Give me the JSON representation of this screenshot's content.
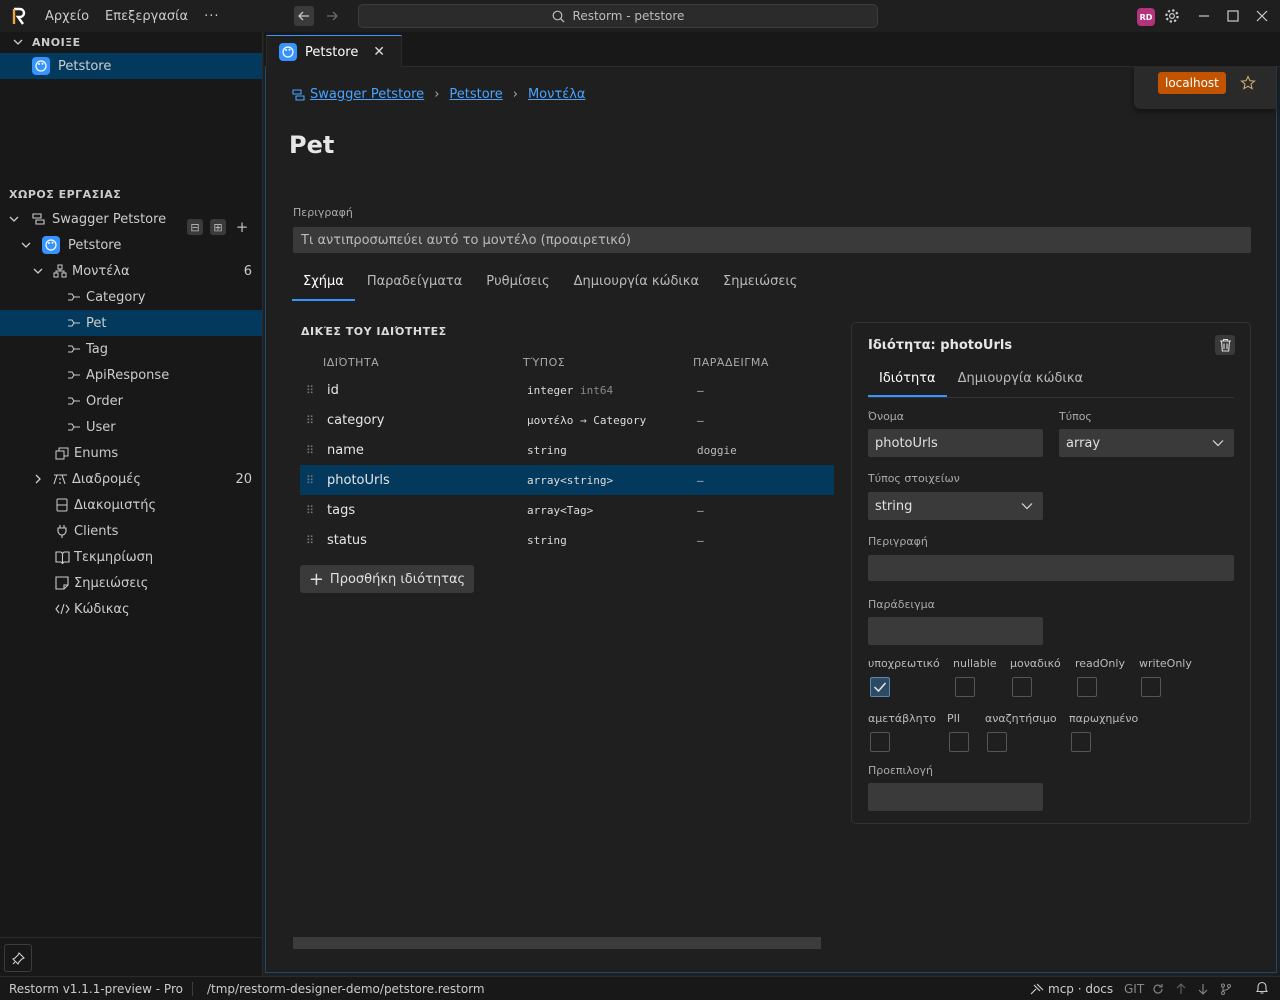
{
  "titlebar": {
    "menus": [
      "Αρχείο",
      "Επεξεργασία"
    ],
    "more": "···",
    "search_text": "Restorm - petstore",
    "avatar_initials": "RD"
  },
  "sidebar": {
    "open_header": "ΑΝΟΙΞΕ",
    "open_item": "Petstore",
    "workspace_header": "ΧΩΡΟΣ ΕΡΓΑΣΙΑΣ",
    "tree": {
      "root": "Swagger Petstore",
      "api": "Petstore",
      "models": {
        "label": "Μοντέλα",
        "count": "6"
      },
      "model_items": [
        "Category",
        "Pet",
        "Tag",
        "ApiResponse",
        "Order",
        "User"
      ],
      "enums": "Enums",
      "routes": {
        "label": "Διαδρομές",
        "count": "20"
      },
      "servers": "Διακομιστής",
      "clients": "Clients",
      "docs": "Τεκμηρίωση",
      "notes": "Σημειώσεις",
      "code": "Κώδικας"
    }
  },
  "editor_tab": {
    "label": "Petstore",
    "close": "✕"
  },
  "env": {
    "badge": "localhost"
  },
  "breadcrumb": [
    "Swagger Petstore",
    "Petstore",
    "Μοντέλα"
  ],
  "model": {
    "title": "Pet",
    "description_label": "Περιγραφή",
    "description_placeholder": "Τι αντιπροσωπεύει αυτό το μοντέλο (προαιρετικό)"
  },
  "tabs": [
    "Σχήμα",
    "Παραδείγματα",
    "Ρυθμίσεις",
    "Δημιουργία κώδικα",
    "Σημειώσεις"
  ],
  "properties": {
    "header": "ΔΙΚΈΣ ΤΟΥ ΙΔΙΌΤΗΤΕΣ",
    "columns": [
      "ΙΔΙΌΤΗΤΑ",
      "ΤΎΠΟΣ",
      "ΠΑΡΆΔΕΙΓΜΑ"
    ],
    "rows": [
      {
        "name": "id",
        "type": "integer",
        "format": "int64",
        "example": "–"
      },
      {
        "name": "category",
        "type": "μοντέλο → Category",
        "format": "",
        "example": "–"
      },
      {
        "name": "name",
        "type": "string",
        "format": "",
        "example": "doggie"
      },
      {
        "name": "photoUrls",
        "type": "array<string>",
        "format": "",
        "example": "–"
      },
      {
        "name": "tags",
        "type": "array<Tag>",
        "format": "",
        "example": "–"
      },
      {
        "name": "status",
        "type": "string",
        "format": "",
        "example": "–"
      }
    ],
    "add_label": "Προσθήκη ιδιότητας"
  },
  "detail": {
    "title": "Ιδιότητα: photoUrls",
    "tabs": [
      "Ιδιότητα",
      "Δημιουργία κώδικα"
    ],
    "name_label": "Όνομα",
    "name_value": "photoUrls",
    "type_label": "Τύπος",
    "type_value": "array",
    "item_type_label": "Τύπος στοιχείων",
    "item_type_value": "string",
    "description_label": "Περιγραφή",
    "example_label": "Παράδειγμα",
    "flags": [
      {
        "label": "υποχρεωτικό",
        "checked": true
      },
      {
        "label": "nullable",
        "checked": false
      },
      {
        "label": "μοναδικό",
        "checked": false
      },
      {
        "label": "readOnly",
        "checked": false
      },
      {
        "label": "writeOnly",
        "checked": false
      },
      {
        "label": "αμετάβλητο",
        "checked": false
      },
      {
        "label": "PII",
        "checked": false
      },
      {
        "label": "αναζητήσιμο",
        "checked": false
      },
      {
        "label": "παρωχημένο",
        "checked": false
      }
    ],
    "default_label": "Προεπιλογή"
  },
  "statusbar": {
    "version": "Restorm v1.1.1-preview - Pro",
    "path": "/tmp/restorm-designer-demo/petstore.restorm",
    "mcp": "mcp · docs",
    "git": "GIT"
  },
  "colors": {
    "accent": "#3794ff",
    "selection": "#04395e",
    "env_badge": "#c25400"
  }
}
